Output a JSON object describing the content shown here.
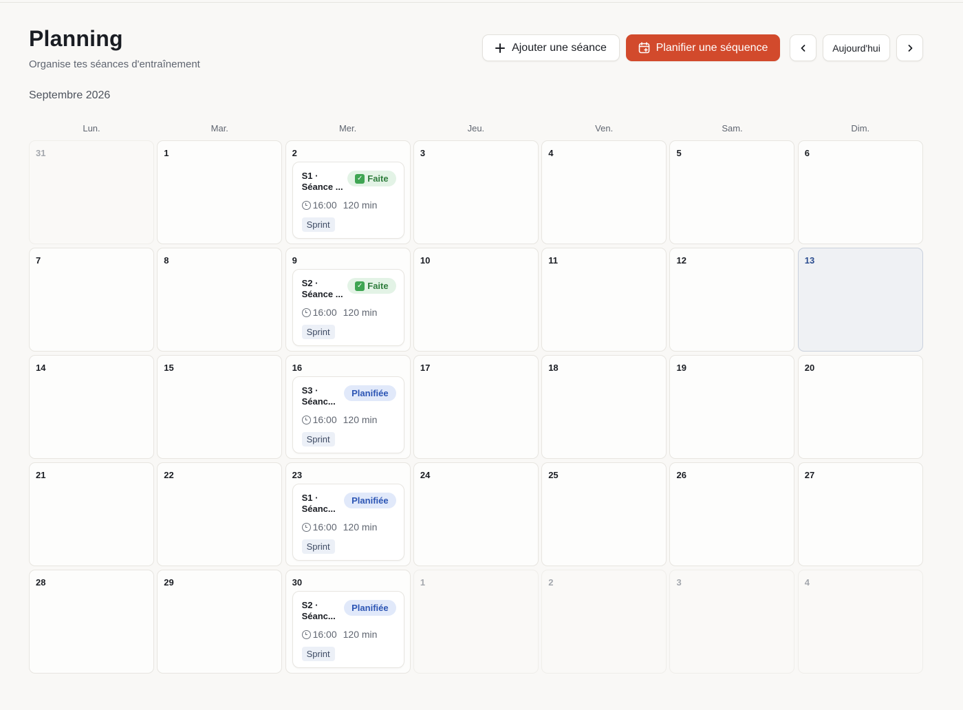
{
  "header": {
    "title": "Planning",
    "subtitle": "Organise tes séances d'entraînement"
  },
  "actions": {
    "add_label": "Ajouter une séance",
    "plan_label": "Planifier une séquence",
    "today_label": "Aujourd'hui",
    "prev_icon": "chevron-left-icon",
    "next_icon": "chevron-right-icon"
  },
  "colors": {
    "accent": "#d24a2c",
    "done_bg": "#e3f3e6",
    "planned_bg": "#e1e9fa"
  },
  "calendar": {
    "month_label": "Septembre 2026",
    "weekdays": [
      "Lun.",
      "Mar.",
      "Mer.",
      "Jeu.",
      "Ven.",
      "Sam.",
      "Dim."
    ],
    "days": [
      {
        "num": "31",
        "outside": true
      },
      {
        "num": "1"
      },
      {
        "num": "2",
        "event": {
          "code": "S1 ·",
          "name": "Séance ...",
          "status": "Faite",
          "state": "done",
          "time": "16:00",
          "duration": "120 min",
          "tag": "Sprint"
        }
      },
      {
        "num": "3"
      },
      {
        "num": "4"
      },
      {
        "num": "5"
      },
      {
        "num": "6"
      },
      {
        "num": "7"
      },
      {
        "num": "8"
      },
      {
        "num": "9",
        "event": {
          "code": "S2 ·",
          "name": "Séance ...",
          "status": "Faite",
          "state": "done",
          "time": "16:00",
          "duration": "120 min",
          "tag": "Sprint"
        }
      },
      {
        "num": "10"
      },
      {
        "num": "11"
      },
      {
        "num": "12"
      },
      {
        "num": "13",
        "today": true
      },
      {
        "num": "14"
      },
      {
        "num": "15"
      },
      {
        "num": "16",
        "event": {
          "code": "S3 ·",
          "name": "Séanc...",
          "status": "Planifiée",
          "state": "planned",
          "time": "16:00",
          "duration": "120 min",
          "tag": "Sprint"
        }
      },
      {
        "num": "17"
      },
      {
        "num": "18"
      },
      {
        "num": "19"
      },
      {
        "num": "20"
      },
      {
        "num": "21"
      },
      {
        "num": "22"
      },
      {
        "num": "23",
        "event": {
          "code": "S1 ·",
          "name": "Séanc...",
          "status": "Planifiée",
          "state": "planned",
          "time": "16:00",
          "duration": "120 min",
          "tag": "Sprint"
        }
      },
      {
        "num": "24"
      },
      {
        "num": "25"
      },
      {
        "num": "26"
      },
      {
        "num": "27"
      },
      {
        "num": "28"
      },
      {
        "num": "29"
      },
      {
        "num": "30",
        "event": {
          "code": "S2 ·",
          "name": "Séanc...",
          "status": "Planifiée",
          "state": "planned",
          "time": "16:00",
          "duration": "120 min",
          "tag": "Sprint"
        }
      },
      {
        "num": "1",
        "outside": true
      },
      {
        "num": "2",
        "outside": true
      },
      {
        "num": "3",
        "outside": true
      },
      {
        "num": "4",
        "outside": true
      }
    ]
  }
}
